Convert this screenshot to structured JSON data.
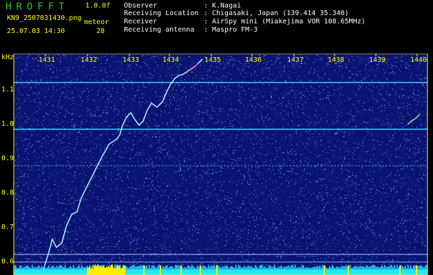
{
  "header": {
    "brand": "HROFFT",
    "version": "1.0.0f",
    "file_name": "KN9_2507031430.png",
    "software": "meteor",
    "datetime": "25.07.03 14:30",
    "count": "28",
    "meta": [
      {
        "label": "Observer",
        "value": "K.Nagai"
      },
      {
        "label": "Receiving Location",
        "value": "Chigasaki, Japan (139.414 35.340)"
      },
      {
        "label": "Receiver",
        "value": "AirSpy mini (Miakejima VOR 108.65MHz)"
      },
      {
        "label": "Receiving antenna",
        "value": "Maspro FM-3"
      }
    ]
  },
  "spectrogram": {
    "y_unit": "kHz",
    "x_ticks": [
      "1431",
      "1432",
      "1433",
      "1434",
      "1435",
      "1436",
      "1437",
      "1438",
      "1439",
      "1440"
    ],
    "y_ticks": [
      "1.1",
      "1.0",
      "0.9",
      "0.8",
      "0.7",
      "0.6"
    ],
    "colors": {
      "background": "#0a1470",
      "frame": "#ffff00",
      "label": "#ffff00",
      "line": "#3bd0ff",
      "trace": "#a6f0ff",
      "baseline": "#22e6ff",
      "burst": "#ffee00"
    }
  }
}
